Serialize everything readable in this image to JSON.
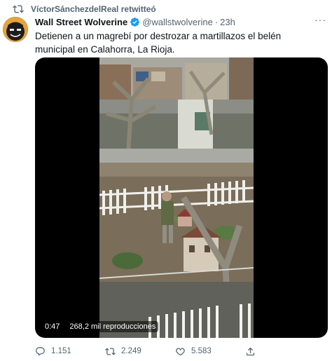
{
  "retweet": {
    "user": "VíctorSánchezdelReal",
    "suffix": "retwitteó",
    "icon": "retweet-icon"
  },
  "tweet": {
    "display_name": "Wall Street Wolverine",
    "handle": "@wallstwolverine",
    "separator": "·",
    "time": "23h",
    "more": "···",
    "text": "Detienen a un magrebí por destrozar a martillazos el belén municipal en Calahorra, La Rioja."
  },
  "video": {
    "duration": "0:47",
    "views": "268,2 mil reproducciones"
  },
  "actions": {
    "reply_count": "1.151",
    "retweet_count": "2.249",
    "like_count": "5.583"
  },
  "colors": {
    "text": "#0f1419",
    "secondary": "#536471",
    "verified": "#1d9bf0"
  }
}
